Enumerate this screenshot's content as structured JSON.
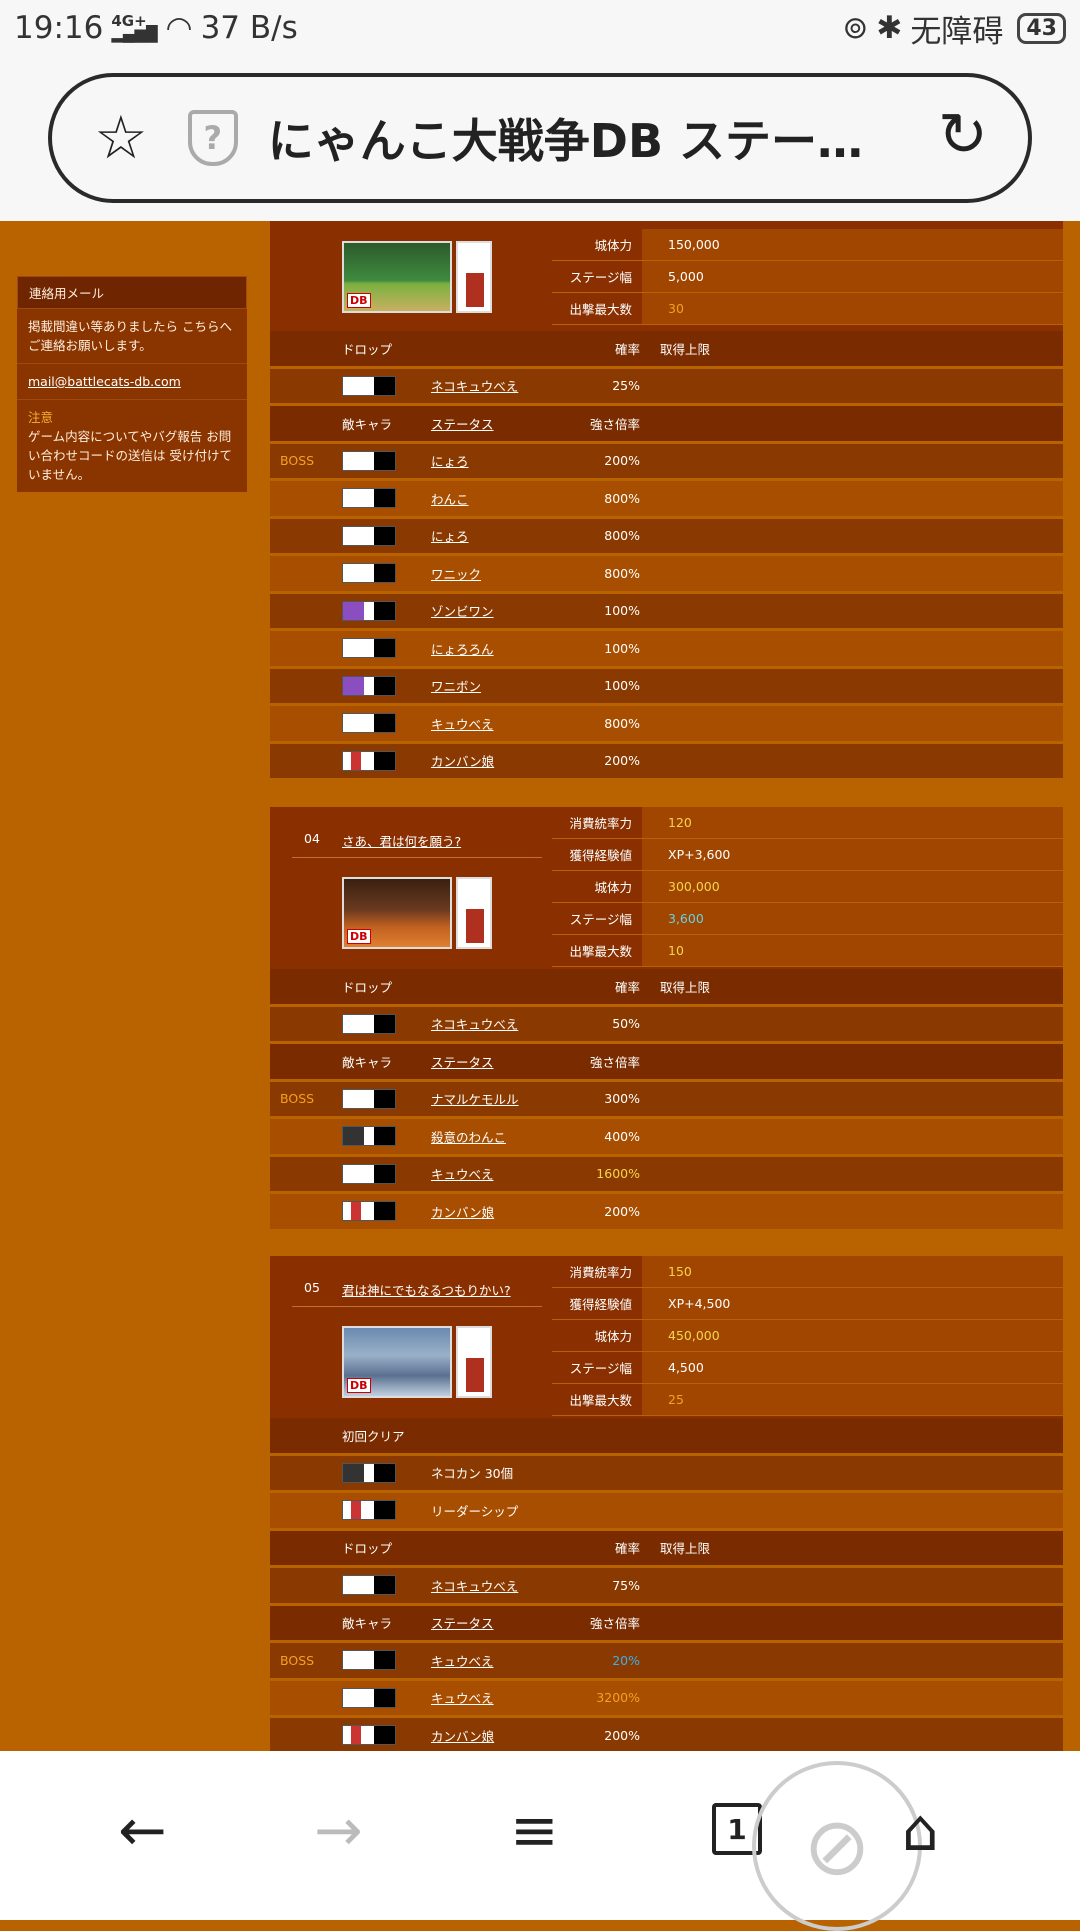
{
  "status": {
    "time": "19:16",
    "network": "4G+",
    "speed": "37 B/s",
    "accessibility": "无障碍",
    "battery": "43"
  },
  "browser": {
    "title": "にゃんこ大戦争DB ステー…",
    "tab_count": "1"
  },
  "sidebar": {
    "contact_heading": "連絡用メール",
    "contact_text": "掲載間違い等ありましたら こちらへご連絡お願いします。",
    "email": "mail@battlecats-db.com",
    "notice_heading": "注意",
    "notice_text": "ゲーム内容についてやバグ報告 お問い合わせコードの送信は 受け付けていません。"
  },
  "labels": {
    "drop": "ドロップ",
    "rate": "確率",
    "limit": "取得上限",
    "enemy": "敵キャラ",
    "status": "ステータス",
    "strength": "強さ倍率",
    "cost": "消費統率力",
    "xp": "獲得経験値",
    "castle_hp": "城体力",
    "width": "ステージ幅",
    "max_units": "出撃最大数",
    "first_clear": "初回クリア",
    "boss": "BOSS",
    "db": "DB"
  },
  "stage03": {
    "castle_hp": "150,000",
    "width": "5,000",
    "max_units": "30",
    "drops": [
      {
        "name": "ネコキュウべえ",
        "rate": "25%"
      }
    ],
    "enemies": [
      {
        "boss": "BOSS",
        "name": "にょろ",
        "mult": "200%",
        "icon": "w"
      },
      {
        "boss": "",
        "name": "わんこ",
        "mult": "800%",
        "icon": "w"
      },
      {
        "boss": "",
        "name": "にょろ",
        "mult": "800%",
        "icon": "w"
      },
      {
        "boss": "",
        "name": "ワニック",
        "mult": "800%",
        "icon": "w"
      },
      {
        "boss": "",
        "name": "ゾンビワン",
        "mult": "100%",
        "icon": "p"
      },
      {
        "boss": "",
        "name": "にょろろん",
        "mult": "100%",
        "icon": "w"
      },
      {
        "boss": "",
        "name": "ワニボン",
        "mult": "100%",
        "icon": "p"
      },
      {
        "boss": "",
        "name": "キュウべえ",
        "mult": "800%",
        "icon": "w"
      },
      {
        "boss": "",
        "name": "カンバン娘",
        "mult": "200%",
        "icon": "r"
      }
    ]
  },
  "stage04": {
    "num": "04",
    "name": "さあ、君は何を願う?",
    "cost": "120",
    "xp": "XP+3,600",
    "castle_hp": "300,000",
    "width": "3,600",
    "max_units": "10",
    "drops": [
      {
        "name": "ネコキュウべえ",
        "rate": "50%"
      }
    ],
    "enemies": [
      {
        "boss": "BOSS",
        "name": "ナマルケモルル",
        "mult": "300%",
        "icon": "w"
      },
      {
        "boss": "",
        "name": "殺意のわんこ",
        "mult": "400%",
        "icon": "d"
      },
      {
        "boss": "",
        "name": "キュウべえ",
        "mult": "1600%",
        "icon": "w"
      },
      {
        "boss": "",
        "name": "カンバン娘",
        "mult": "200%",
        "icon": "r"
      }
    ]
  },
  "stage05": {
    "num": "05",
    "name": "君は神にでもなるつもりかい?",
    "cost": "150",
    "xp": "XP+4,500",
    "castle_hp": "450,000",
    "width": "4,500",
    "max_units": "25",
    "first_clear": [
      "ネコカン 30個",
      "リーダーシップ"
    ],
    "drops": [
      {
        "name": "ネコキュウべえ",
        "rate": "75%"
      }
    ],
    "enemies": [
      {
        "boss": "BOSS",
        "name": "キュウべえ",
        "mult": "20%",
        "icon": "w"
      },
      {
        "boss": "",
        "name": "キュウべえ",
        "mult": "3200%",
        "icon": "w"
      },
      {
        "boss": "",
        "name": "カンバン娘",
        "mult": "200%",
        "icon": "r"
      }
    ]
  }
}
